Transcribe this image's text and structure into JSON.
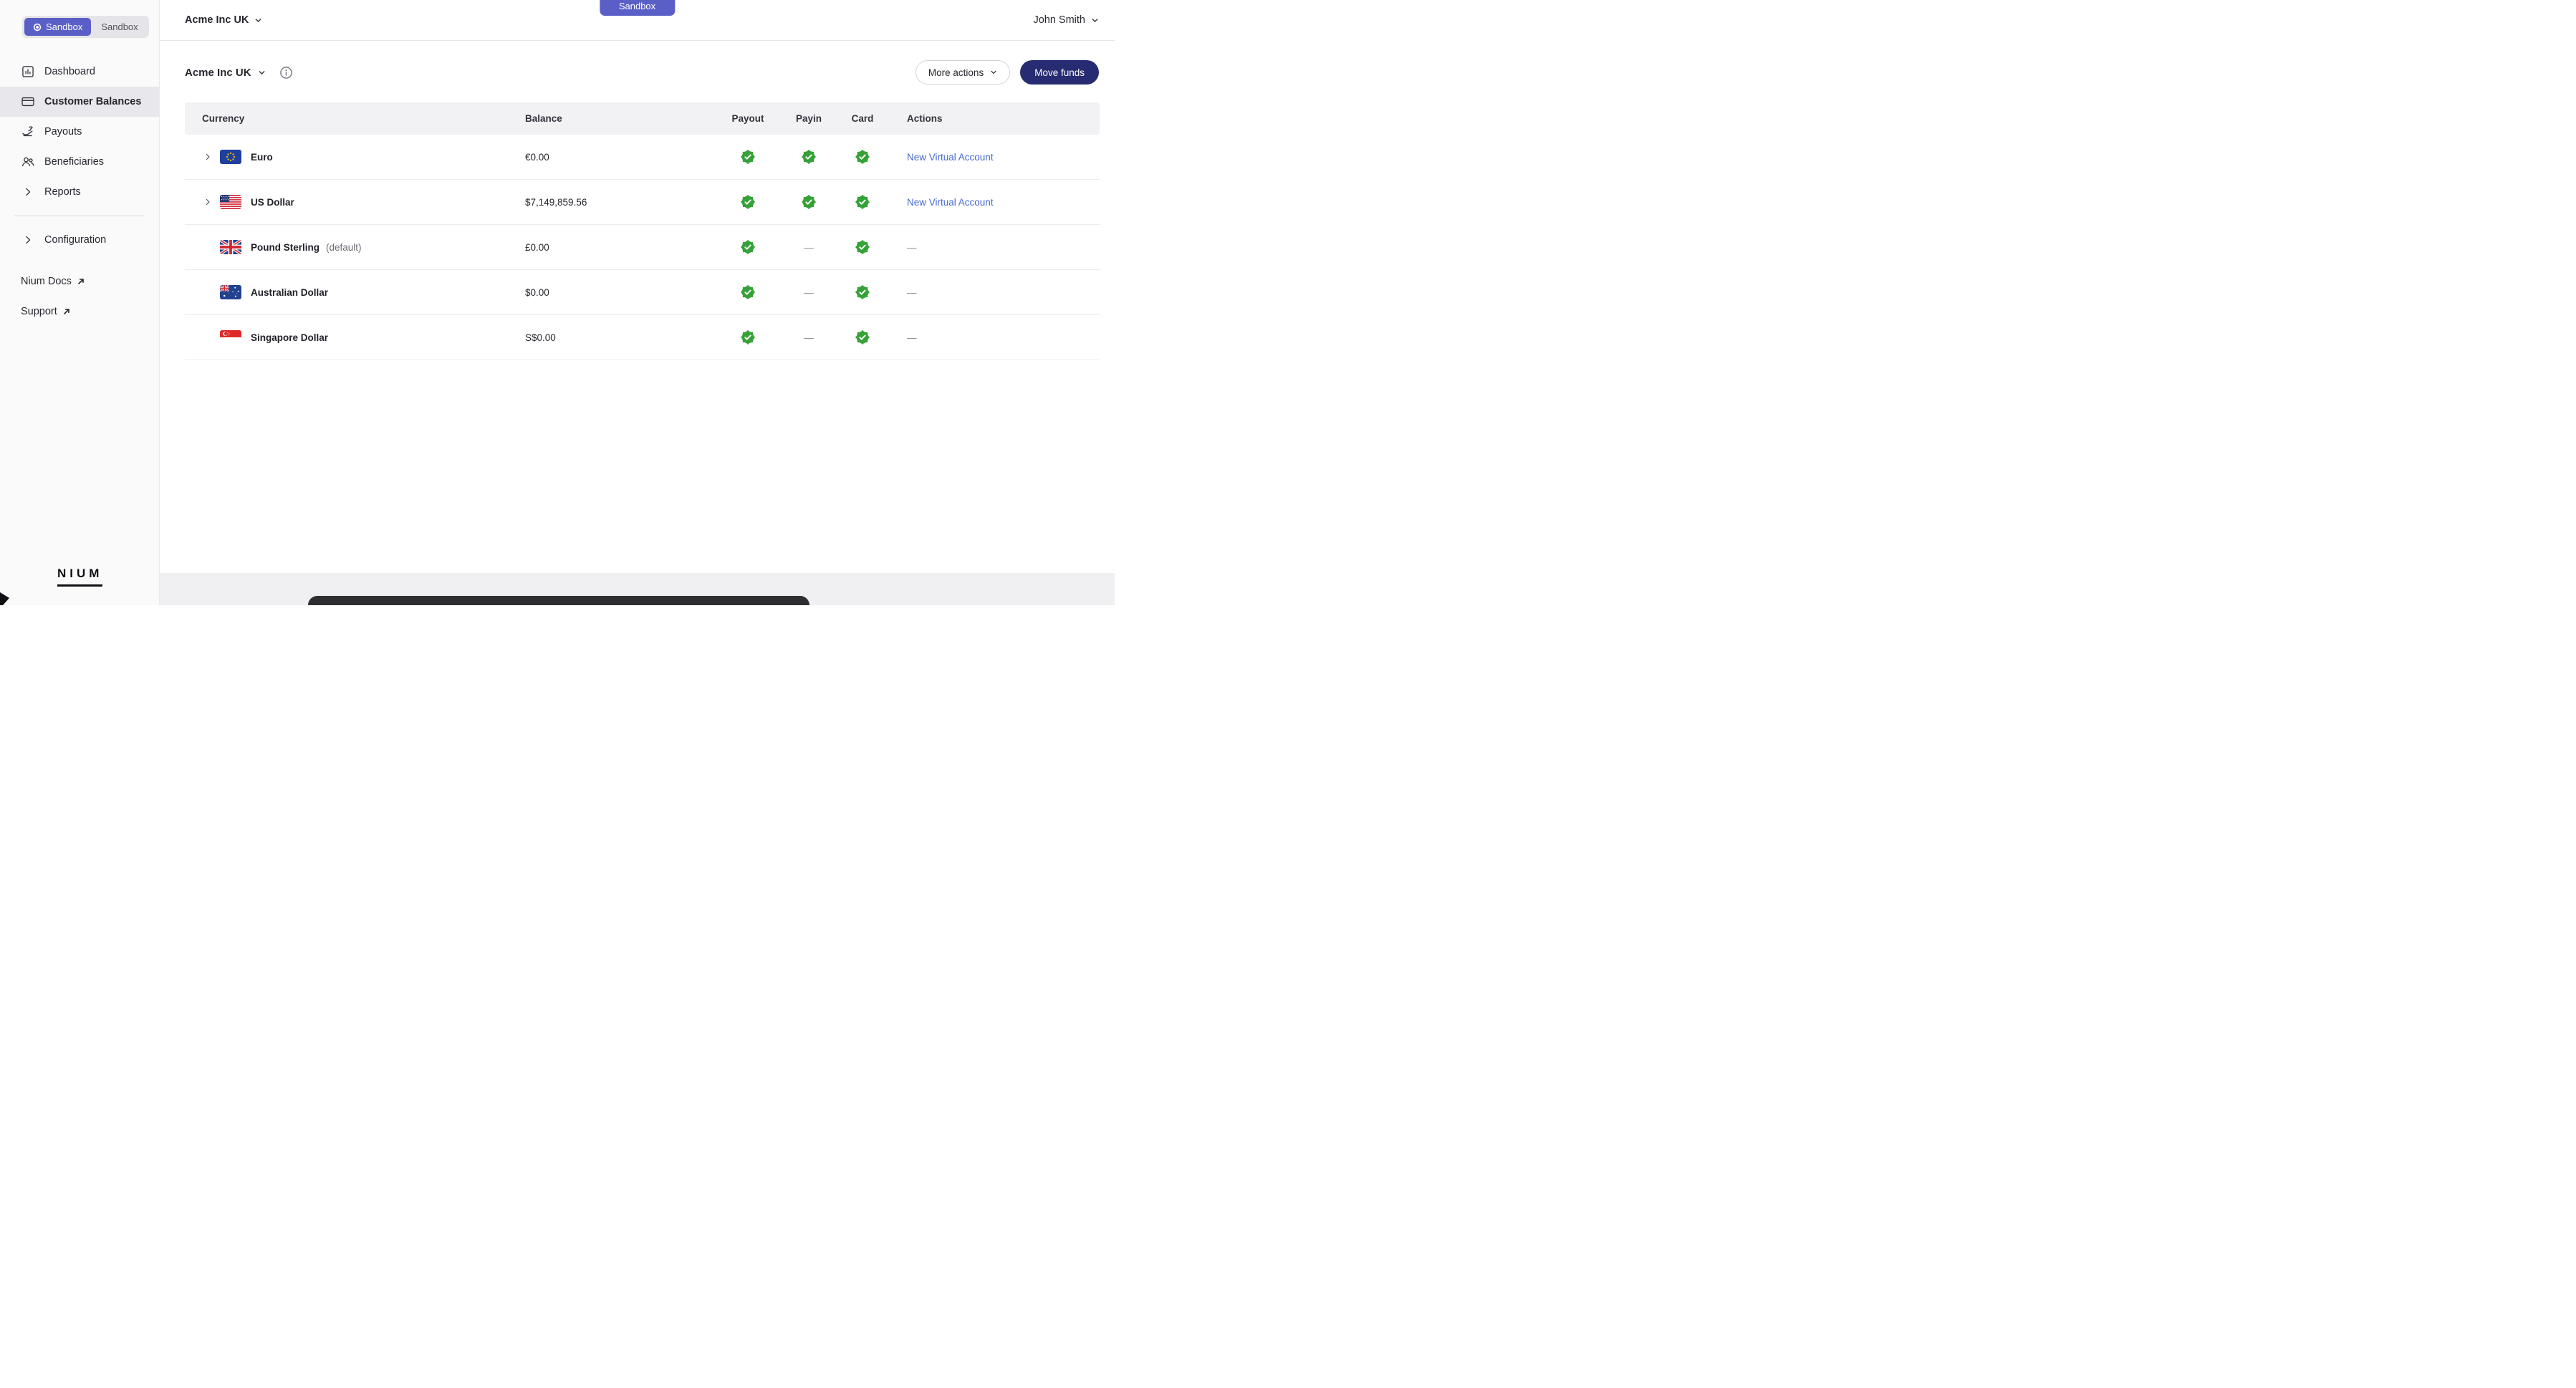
{
  "sidebar": {
    "env_toggle": {
      "active_label": "Sandbox",
      "inactive_label": "Sandbox"
    },
    "items": [
      {
        "label": "Dashboard",
        "icon": "dashboard-icon",
        "active": false
      },
      {
        "label": "Customer Balances",
        "icon": "card-icon",
        "active": true
      },
      {
        "label": "Payouts",
        "icon": "payout-icon",
        "active": false
      },
      {
        "label": "Beneficiaries",
        "icon": "people-icon",
        "active": false
      },
      {
        "label": "Reports",
        "icon": "chevron-right-icon",
        "active": false
      }
    ],
    "secondary_items": [
      {
        "label": "Configuration",
        "icon": "chevron-right-icon",
        "active": false
      }
    ],
    "external_links": [
      {
        "label": "Nium Docs"
      },
      {
        "label": "Support"
      }
    ],
    "logo_text": "NIUM"
  },
  "topbar": {
    "org_name": "Acme Inc UK",
    "env_badge": "Sandbox",
    "user_name": "John Smith"
  },
  "page_header": {
    "title": "Acme Inc UK",
    "more_actions_label": "More actions",
    "move_funds_label": "Move funds"
  },
  "balances_table": {
    "columns": [
      "Currency",
      "Balance",
      "Payout",
      "Payin",
      "Card",
      "Actions"
    ],
    "rows": [
      {
        "currency": "Euro",
        "flag": "eu",
        "suffix": "",
        "balance": "€0.00",
        "payout": "check",
        "payin": "check",
        "card": "check",
        "action": "New Virtual Account",
        "expandable": true
      },
      {
        "currency": "US Dollar",
        "flag": "us",
        "suffix": "",
        "balance": "$7,149,859.56",
        "payout": "check",
        "payin": "check",
        "card": "check",
        "action": "New Virtual Account",
        "expandable": true
      },
      {
        "currency": "Pound Sterling",
        "flag": "gb",
        "suffix": "(default)",
        "balance": "£0.00",
        "payout": "check",
        "payin": "dash",
        "card": "check",
        "action": "dash",
        "expandable": false
      },
      {
        "currency": "Australian Dollar",
        "flag": "au",
        "suffix": "",
        "balance": "$0.00",
        "payout": "check",
        "payin": "dash",
        "card": "check",
        "action": "dash",
        "expandable": false
      },
      {
        "currency": "Singapore Dollar",
        "flag": "sg",
        "suffix": "",
        "balance": "S$0.00",
        "payout": "check",
        "payin": "dash",
        "card": "check",
        "action": "dash",
        "expandable": false
      }
    ]
  },
  "colors": {
    "accent_indigo": "#5a5fc7",
    "primary_button": "#262b72",
    "link_blue": "#4468d1",
    "success_green": "#36a138"
  }
}
